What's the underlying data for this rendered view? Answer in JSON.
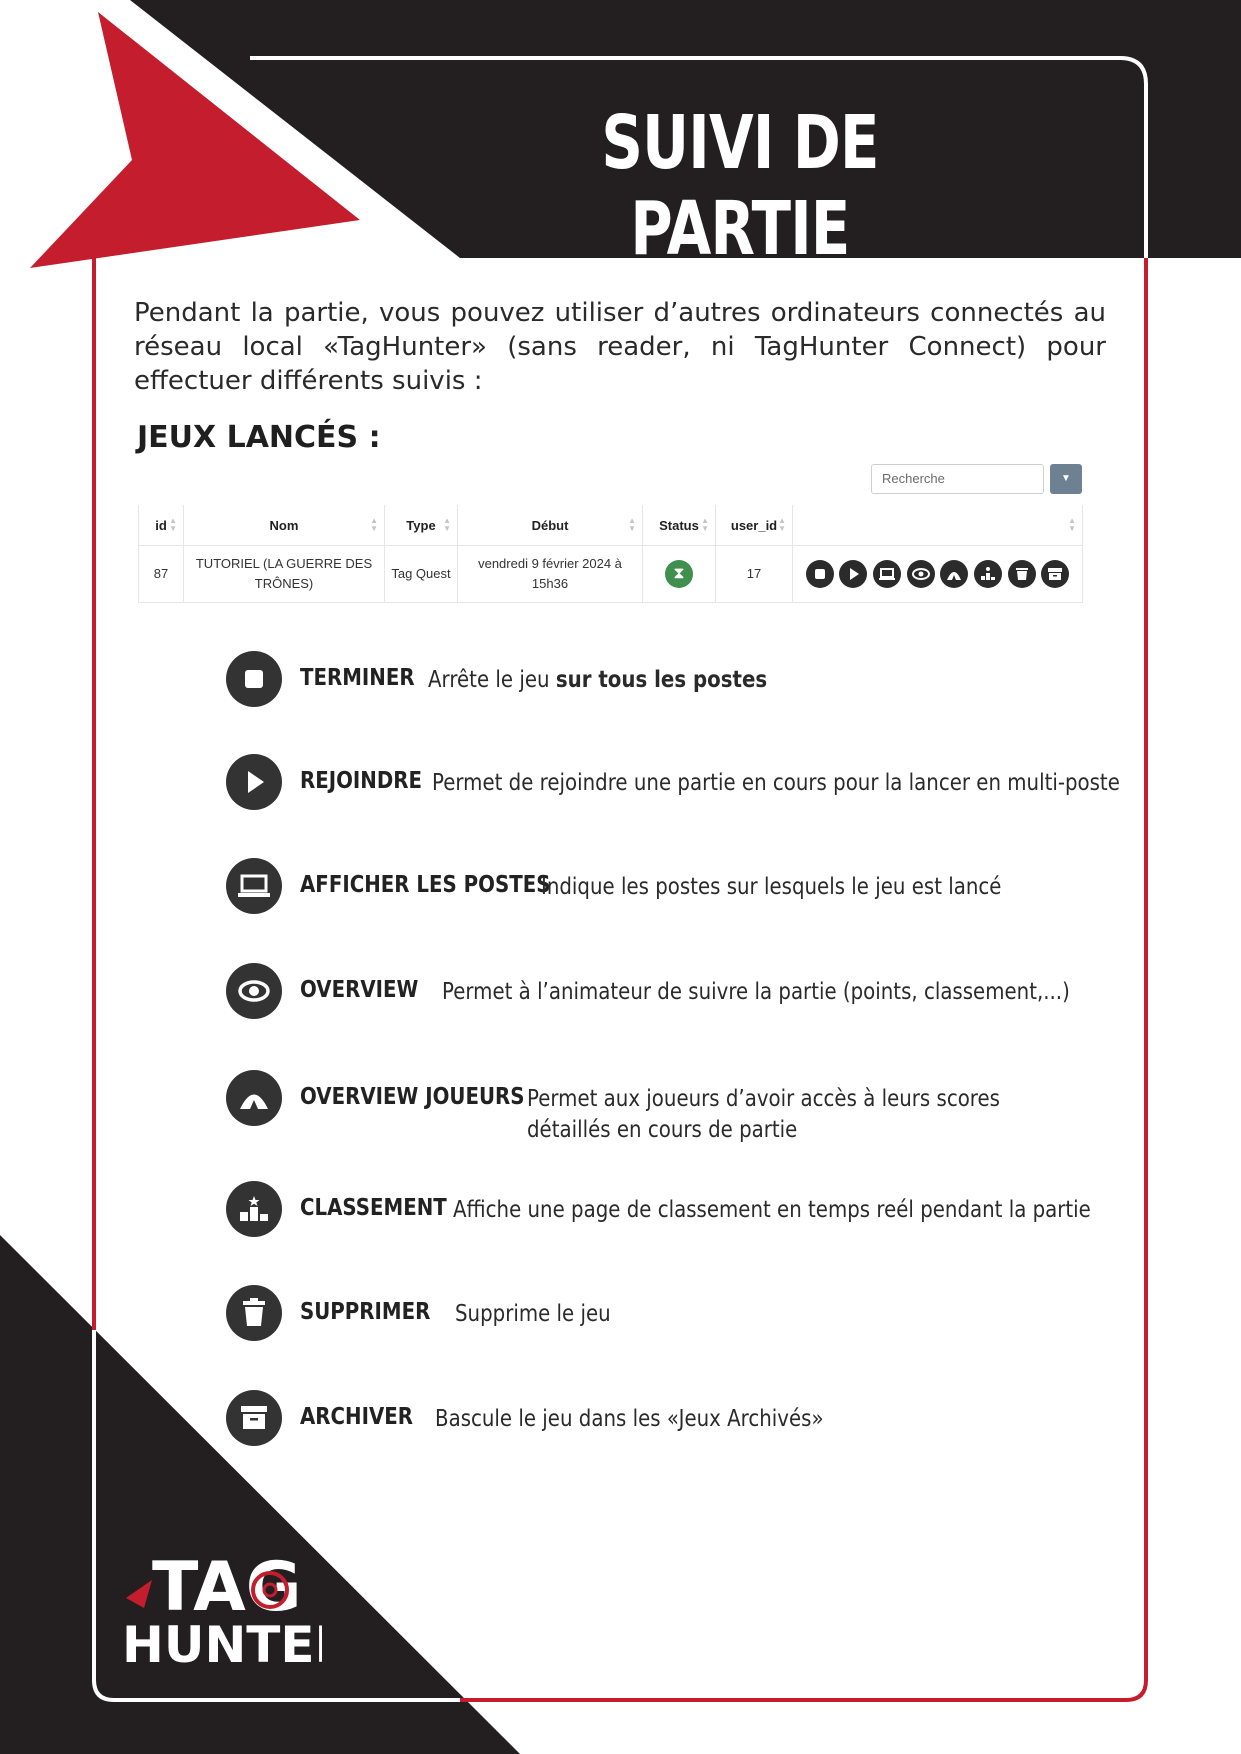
{
  "header": {
    "title": "SUIVI DE PARTIE"
  },
  "intro": {
    "text": "Pendant la partie, vous pouvez utiliser d’autres ordinateurs connectés au réseau local «TagHunter» (sans reader, ni TagHunter Connect) pour effectuer différents suivis :"
  },
  "section": {
    "title": "JEUX LANCÉS :"
  },
  "search": {
    "placeholder": "Recherche"
  },
  "table": {
    "headers": [
      "id",
      "Nom",
      "Type",
      "Début",
      "Status",
      "user_id",
      ""
    ],
    "rows": [
      {
        "id": "87",
        "nom": "TUTORIEL (LA GUERRE DES TRÔNES)",
        "type": "Tag Quest",
        "debut": "vendredi 9 février 2024 à 15h36",
        "status_icon": "hourglass-icon",
        "user_id": "17"
      }
    ]
  },
  "legend": [
    {
      "name": "TERMINER",
      "desc_plain": "Arrête le jeu ",
      "desc_bold": "sur tous les postes",
      "icon": "stop-icon"
    },
    {
      "name": "REJOINDRE",
      "desc_plain": "Permet de rejoindre une partie en cours pour la lancer en multi-poste",
      "icon": "play-icon"
    },
    {
      "name": "AFFICHER LES POSTES",
      "desc_plain": "Indique les postes sur lesquels le jeu est lancé",
      "icon": "laptop-icon"
    },
    {
      "name": "OVERVIEW",
      "desc_plain": "Permet à l’animateur de suivre la partie (points, classement,...)",
      "icon": "eye-icon"
    },
    {
      "name": "OVERVIEW JOUEURS",
      "desc_plain": "Permet aux joueurs d’avoir accès à leurs scores détaillés en cours de partie",
      "icon": "tent-icon"
    },
    {
      "name": "CLASSEMENT",
      "desc_plain": "Affiche une page de classement en temps reél pendant la partie",
      "icon": "podium-icon"
    },
    {
      "name": "SUPPRIMER",
      "desc_plain": "Supprime le jeu",
      "icon": "trash-icon"
    },
    {
      "name": "ARCHIVER",
      "desc_plain": "Bascule le jeu dans les «Jeux Archivés»",
      "icon": "archive-icon"
    }
  ],
  "logo": {
    "line1": "TAG",
    "line2": "HUNTER"
  },
  "colors": {
    "red": "#c41e2e",
    "black": "#231f20",
    "frame_white": "#ffffff",
    "status_green": "#3f8f4f"
  }
}
